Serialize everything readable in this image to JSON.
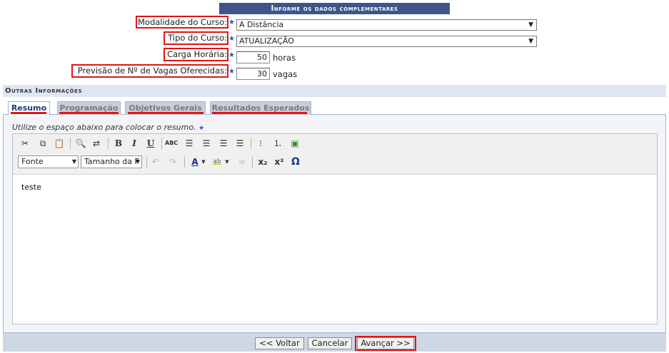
{
  "header": {
    "title": "Informe os dados complementares"
  },
  "form": {
    "modalidade": {
      "label": "Modalidade do Curso:",
      "value": "A Distância"
    },
    "tipo": {
      "label": "Tipo do Curso:",
      "value": "ATUALIZAÇÃO"
    },
    "carga": {
      "label": "Carga Horária:",
      "value": "50",
      "unit": "horas"
    },
    "vagas": {
      "label": "Previsão de Nº de Vagas Oferecidas:",
      "value": "30",
      "unit": "vagas"
    },
    "required_marker": "★"
  },
  "section": {
    "title": "Outras Informações"
  },
  "tabs": [
    {
      "label": "Resumo"
    },
    {
      "label": "Programação"
    },
    {
      "label": "Objetivos Gerais"
    },
    {
      "label": "Resultados Esperados"
    }
  ],
  "editor": {
    "hint": "Utilize o espaço abaixo para colocar o resumo.",
    "font_select": "Fonte",
    "size_select": "Tamanho da F",
    "content": "teste",
    "icons": [
      "cut-icon",
      "copy-icon",
      "paste-icon",
      "find-icon",
      "replace-icon",
      "bold-icon",
      "italic-icon",
      "underline-icon",
      "spellcheck-icon",
      "align-left-icon",
      "align-center-icon",
      "align-right-icon",
      "align-justify-icon",
      "bullet-list-icon",
      "numbered-list-icon",
      "image-icon",
      "undo-icon",
      "redo-icon",
      "font-color-icon",
      "highlight-icon",
      "link-icon",
      "subscript-icon",
      "superscript-icon",
      "special-char-icon"
    ]
  },
  "buttons": {
    "voltar": "<< Voltar",
    "cancelar": "Cancelar",
    "avancar": "Avançar >>"
  },
  "colors": {
    "header_bg": "#3d5589",
    "highlight": "#e01414",
    "star": "#2a55c8"
  }
}
